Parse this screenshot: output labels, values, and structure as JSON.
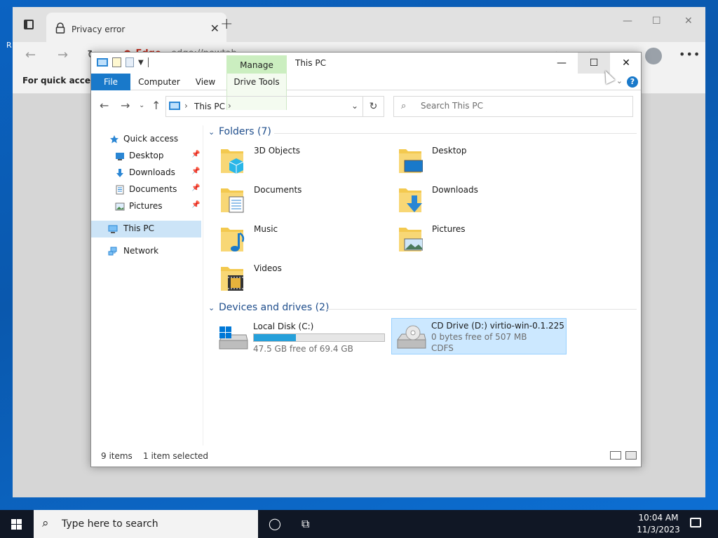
{
  "edge": {
    "tab_title": "Privacy error",
    "brand": "Edge",
    "url": "edge://newtab",
    "favbar_text": "For quick access, p",
    "newtab_symbol": "+",
    "min_symbol": "—",
    "max_symbol": "☐",
    "close_symbol": "✕"
  },
  "explorer": {
    "title": "This PC",
    "manage_tab": "Manage",
    "ribbon": {
      "file": "File",
      "computer": "Computer",
      "view": "View",
      "drive_tools": "Drive Tools",
      "help": "?"
    },
    "window_buttons": {
      "min": "—",
      "max": "☐",
      "close": "✕"
    },
    "address": {
      "crumb": "This PC"
    },
    "search": {
      "placeholder": "Search This PC"
    },
    "navpane": [
      {
        "label": "Quick access",
        "icon": "star-icon"
      },
      {
        "label": "Desktop",
        "icon": "desktop-icon",
        "pinned": true
      },
      {
        "label": "Downloads",
        "icon": "download-icon",
        "pinned": true
      },
      {
        "label": "Documents",
        "icon": "document-icon",
        "pinned": true
      },
      {
        "label": "Pictures",
        "icon": "pictures-icon",
        "pinned": true
      },
      {
        "label": "This PC",
        "icon": "computer-icon",
        "selected": true
      },
      {
        "label": "Network",
        "icon": "network-icon"
      }
    ],
    "folders_header": "Folders (7)",
    "folders": [
      {
        "name": "3D Objects",
        "icon": "3d-objects-folder-icon"
      },
      {
        "name": "Desktop",
        "icon": "desktop-folder-icon"
      },
      {
        "name": "Documents",
        "icon": "documents-folder-icon"
      },
      {
        "name": "Downloads",
        "icon": "downloads-folder-icon"
      },
      {
        "name": "Music",
        "icon": "music-folder-icon"
      },
      {
        "name": "Pictures",
        "icon": "pictures-folder-icon"
      },
      {
        "name": "Videos",
        "icon": "videos-folder-icon"
      }
    ],
    "drives_header": "Devices and drives (2)",
    "drives": [
      {
        "name": "Local Disk (C:)",
        "free": "47.5 GB free of 69.4 GB",
        "used_fraction": 0.32,
        "icon": "hard-disk-icon"
      },
      {
        "name": "CD Drive (D:) virtio-win-0.1.225",
        "free": "0 bytes free of 507 MB",
        "fs": "CDFS",
        "icon": "cd-drive-icon",
        "selected": true
      }
    ],
    "status": {
      "items": "9 items",
      "selected": "1 item selected"
    }
  },
  "taskbar": {
    "search_placeholder": "Type here to search",
    "time": "10:04 AM",
    "date": "11/3/2023"
  },
  "colors": {
    "accent": "#1979ca",
    "selection": "#cce8ff",
    "drive_bar": "#26a0da",
    "manage_green": "#cbeec0"
  }
}
